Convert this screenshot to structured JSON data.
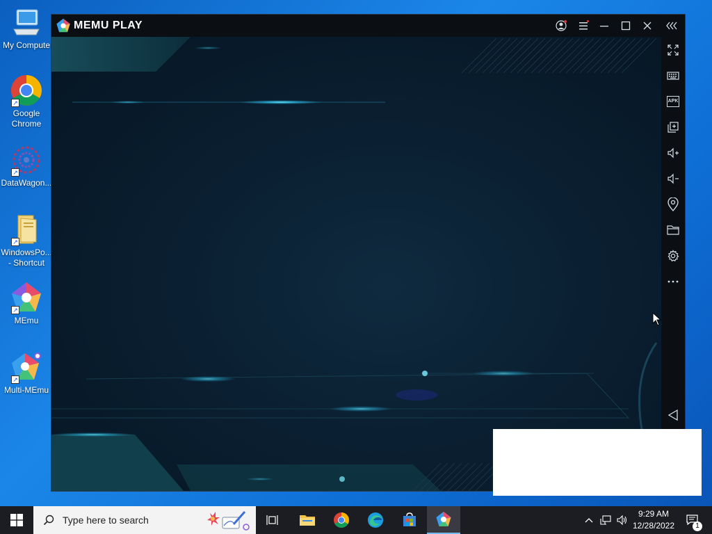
{
  "desktop": {
    "icons": [
      {
        "label": "My Compute",
        "icon": "computer-icon"
      },
      {
        "label": "Google\nChrome",
        "icon": "chrome-icon"
      },
      {
        "label": "DataWagon...",
        "icon": "datawagon-icon"
      },
      {
        "label": "WindowsPo...\n- Shortcut",
        "icon": "folder-icon"
      },
      {
        "label": "MEmu",
        "icon": "memu-icon"
      },
      {
        "label": "Multi-MEmu",
        "icon": "multi-memu-icon"
      }
    ]
  },
  "memu": {
    "brand": "MEMU PLAY",
    "titlebar_buttons": [
      "account-icon",
      "menu-icon",
      "minimize-icon",
      "maximize-icon",
      "close-icon",
      "collapse-sidebar-icon"
    ],
    "sidebar_buttons": [
      "fullscreen-icon",
      "keyboard-icon",
      "apk-icon",
      "multi-window-icon",
      "volume-up-icon",
      "volume-down-icon",
      "location-icon",
      "folder-icon",
      "settings-icon",
      "more-icon",
      "back-icon"
    ],
    "apk_label": "APK"
  },
  "taskbar": {
    "search_placeholder": "Type here to search",
    "apps": [
      "task-view-icon",
      "file-explorer-icon",
      "chrome-icon",
      "edge-icon",
      "store-icon",
      "memu-icon"
    ],
    "time": "9:29 AM",
    "date": "12/28/2022",
    "notification_count": "1"
  },
  "colors": {
    "desktop": "#0a78d7",
    "taskbar": "#1c1d22",
    "memu_bg": "#061522",
    "accent_glow": "#2fd1ff"
  }
}
